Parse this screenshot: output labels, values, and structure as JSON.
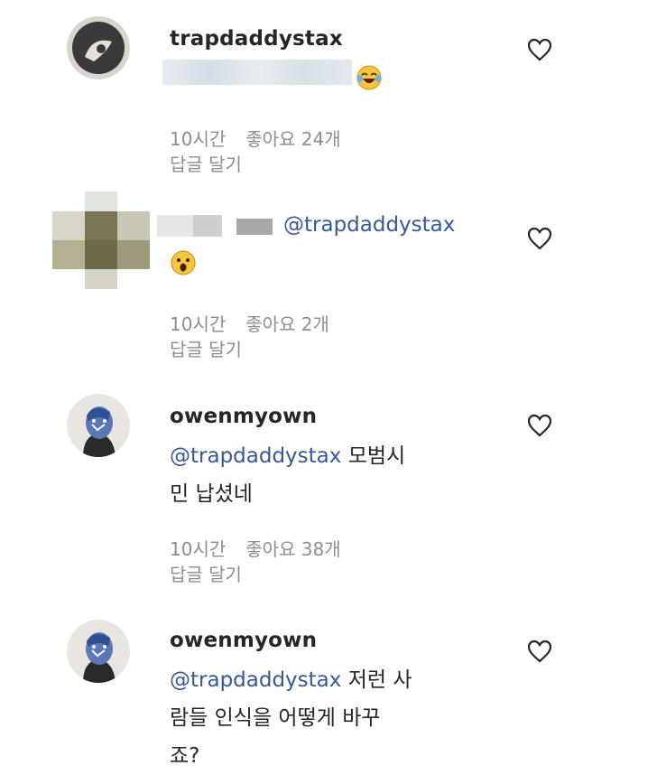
{
  "comments": [
    {
      "username": "trapdaddystax",
      "time": "10시간",
      "likes": "좋아요 24개",
      "reply": "답글 달기"
    },
    {
      "mention": "@trapdaddystax",
      "time": "10시간",
      "likes": "좋아요 2개",
      "reply": "답글 달기"
    },
    {
      "username": "owenmyown",
      "mention": "@trapdaddystax",
      "text_line1": " 모범시",
      "text_line2": "민 납셨네",
      "time": "10시간",
      "likes": "좋아요 38개",
      "reply": "답글 달기"
    },
    {
      "username": "owenmyown",
      "mention": "@trapdaddystax",
      "text_line1": " 저런 사",
      "text_line2": "람들 인식을 어떻게 바꾸",
      "text_line3": "죠?",
      "time": "",
      "likes": "",
      "reply": ""
    }
  ],
  "icons": {
    "heart": "heart-outline-icon",
    "laugh": "face-with-tears-of-joy-emoji",
    "surprised": "face-with-open-mouth-emoji"
  },
  "colors": {
    "mention": "#385898",
    "meta": "#8e8e8e",
    "text": "#262626"
  }
}
